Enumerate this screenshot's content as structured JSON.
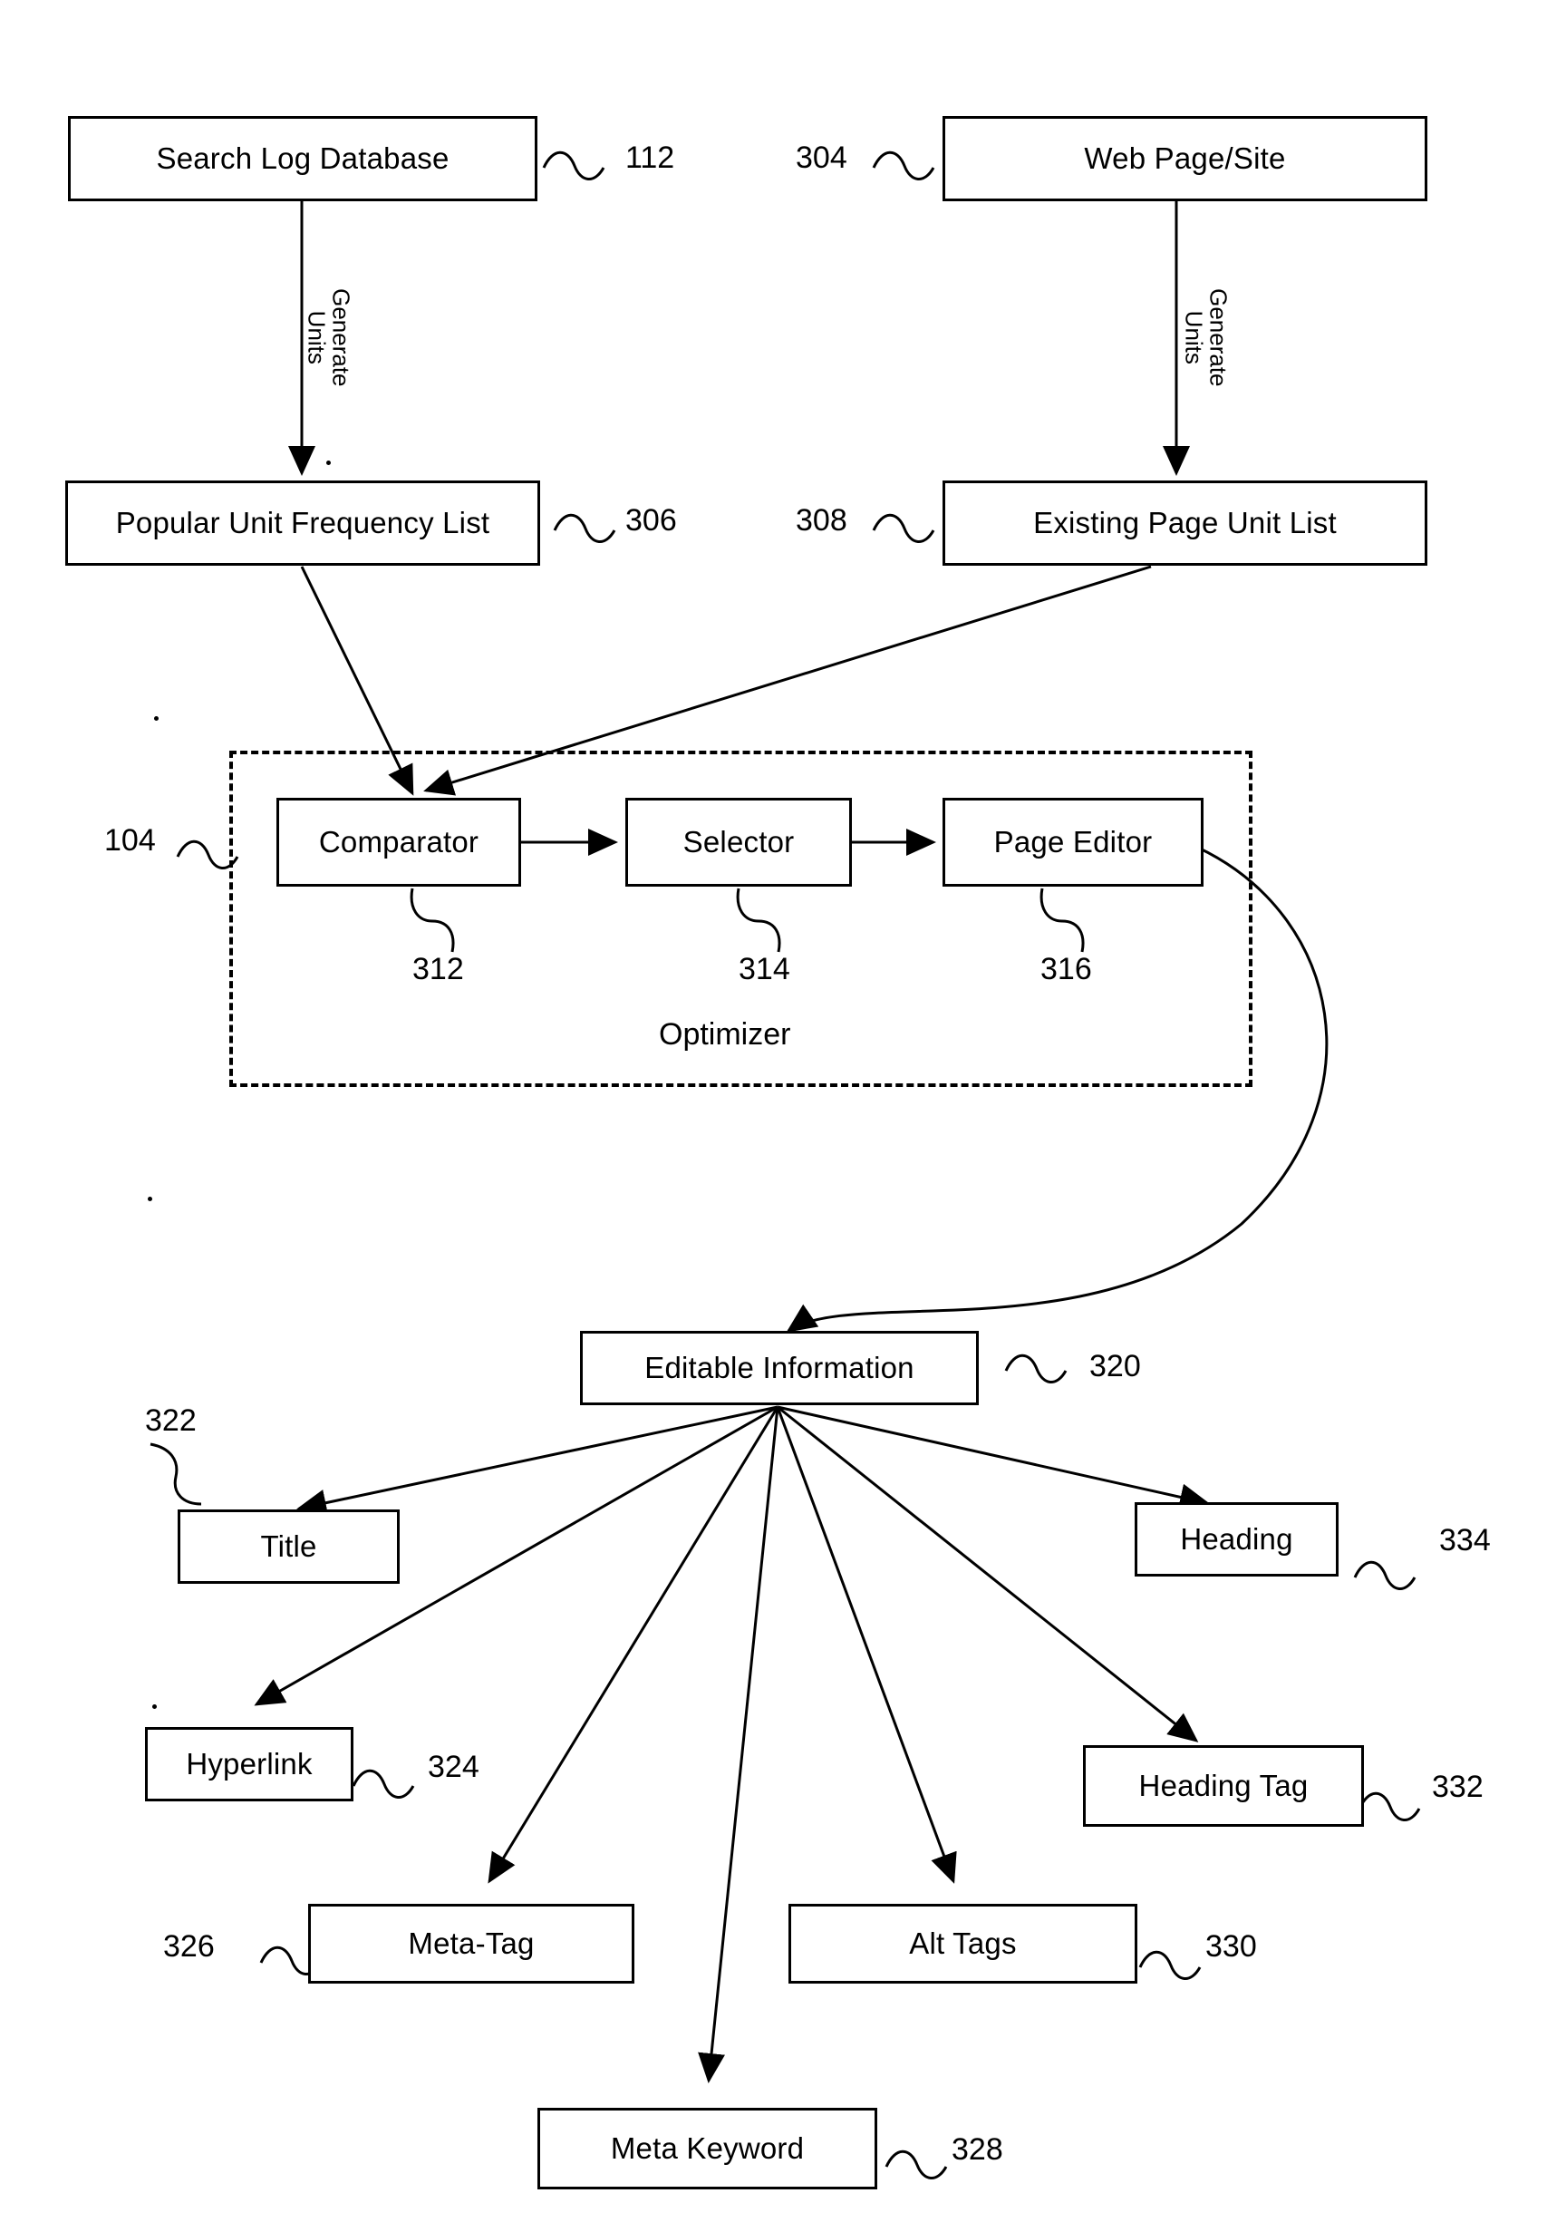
{
  "diagram": {
    "type": "flowchart",
    "title": "",
    "nodes": [
      {
        "id": "search_log_db",
        "label": "Search Log Database",
        "ref": "112"
      },
      {
        "id": "web_page_site",
        "label": "Web Page/Site",
        "ref": "304"
      },
      {
        "id": "popular_unit_freq_list",
        "label": "Popular Unit Frequency List",
        "ref": "306"
      },
      {
        "id": "existing_page_unit_list",
        "label": "Existing Page Unit List",
        "ref": "308"
      },
      {
        "id": "comparator",
        "label": "Comparator",
        "ref": "312"
      },
      {
        "id": "selector",
        "label": "Selector",
        "ref": "314"
      },
      {
        "id": "page_editor",
        "label": "Page Editor",
        "ref": "316"
      },
      {
        "id": "optimizer",
        "label": "Optimizer",
        "ref": "104"
      },
      {
        "id": "editable_information",
        "label": "Editable Information",
        "ref": "320"
      },
      {
        "id": "title",
        "label": "Title",
        "ref": "322"
      },
      {
        "id": "heading",
        "label": "Heading",
        "ref": "334"
      },
      {
        "id": "hyperlink",
        "label": "Hyperlink",
        "ref": "324"
      },
      {
        "id": "heading_tag",
        "label": "Heading Tag",
        "ref": "332"
      },
      {
        "id": "meta_tag",
        "label": "Meta-Tag",
        "ref": "326"
      },
      {
        "id": "alt_tags",
        "label": "Alt Tags",
        "ref": "330"
      },
      {
        "id": "meta_keyword",
        "label": "Meta Keyword",
        "ref": "328"
      }
    ],
    "edge_labels": [
      {
        "id": "generate_units_left",
        "line1": "Generate",
        "line2": "Units"
      },
      {
        "id": "generate_units_right",
        "line1": "Generate",
        "line2": "Units"
      }
    ],
    "labels": {
      "search_log_db": "Search Log Database",
      "web_page_site": "Web Page/Site",
      "popular_unit_freq_list": "Popular Unit Frequency List",
      "existing_page_unit_list": "Existing Page Unit List",
      "comparator": "Comparator",
      "selector": "Selector",
      "page_editor": "Page Editor",
      "optimizer": "Optimizer",
      "editable_information": "Editable Information",
      "title": "Title",
      "heading": "Heading",
      "hyperlink": "Hyperlink",
      "heading_tag": "Heading Tag",
      "meta_tag": "Meta-Tag",
      "alt_tags": "Alt Tags",
      "meta_keyword": "Meta Keyword"
    },
    "refs": {
      "search_log_db": "112",
      "web_page_site": "304",
      "popular_unit_freq_list": "306",
      "existing_page_unit_list": "308",
      "comparator": "312",
      "selector": "314",
      "page_editor": "316",
      "optimizer": "104",
      "editable_information": "320",
      "title": "322",
      "heading": "334",
      "hyperlink": "324",
      "heading_tag": "332",
      "meta_tag": "326",
      "alt_tags": "330",
      "meta_keyword": "328"
    },
    "edge_text": {
      "generate": "Generate",
      "units": "Units"
    },
    "colors": {
      "stroke": "#000000",
      "background": "#ffffff"
    }
  }
}
